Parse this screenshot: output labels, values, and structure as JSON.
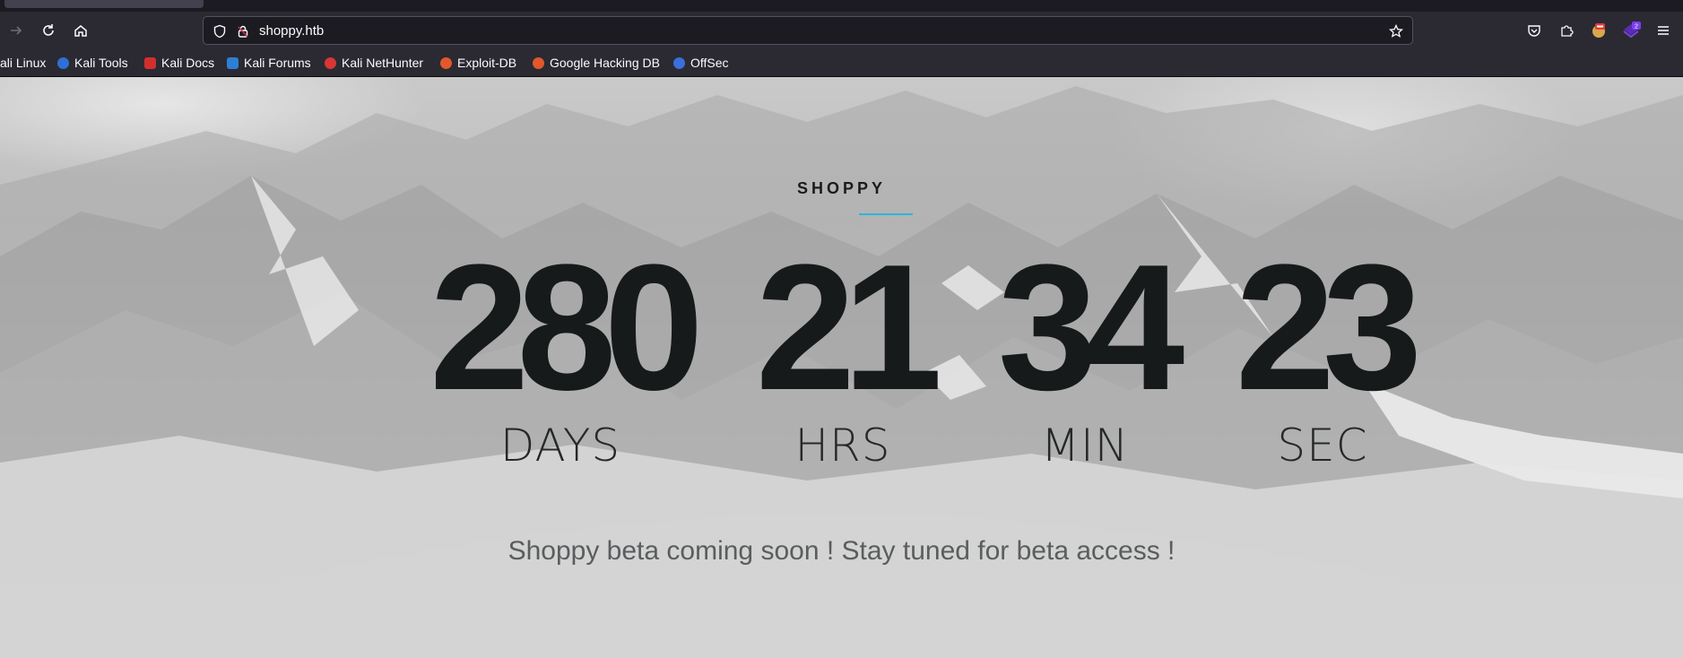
{
  "browser": {
    "url": "shoppy.htb",
    "bookmarks": [
      {
        "label": "ali Linux",
        "color": "#1f78d1"
      },
      {
        "label": "Kali Tools",
        "color": "#2f6fd6"
      },
      {
        "label": "Kali Docs",
        "color": "#d32f2f"
      },
      {
        "label": "Kali Forums",
        "color": "#2d7fd6"
      },
      {
        "label": "Kali NetHunter",
        "color": "#d93636"
      },
      {
        "label": "Exploit-DB",
        "color": "#e2582a"
      },
      {
        "label": "Google Hacking DB",
        "color": "#e2582a"
      },
      {
        "label": "OffSec",
        "color": "#3b6fd9"
      }
    ],
    "extension_badge": "2"
  },
  "page": {
    "brand": "SHOPPY",
    "accent_color": "#31b5d6",
    "countdown": {
      "days": {
        "value": "280",
        "label": "DAYS"
      },
      "hours": {
        "value": "21",
        "label": "HRS"
      },
      "minutes": {
        "value": "34",
        "label": "MIN"
      },
      "seconds": {
        "value": "23",
        "label": "SEC"
      }
    },
    "tagline": "Shoppy beta coming soon ! Stay tuned for beta access !"
  }
}
